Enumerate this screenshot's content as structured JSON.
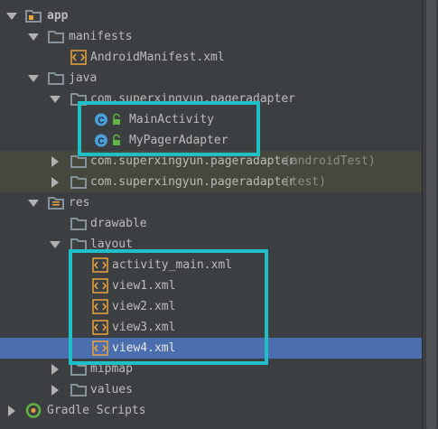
{
  "tree": {
    "app": "app",
    "manifests": "manifests",
    "manifest_file": "AndroidManifest.xml",
    "java": "java",
    "pkg_main": "com.superxingyun.pageradapter",
    "main_activity": "MainActivity",
    "pager_adapter": "MyPagerAdapter",
    "pkg_android_test": "com.superxingyun.pageradapter",
    "pkg_android_test_suffix": "(androidTest)",
    "pkg_test": "com.superxingyun.pageradapter",
    "pkg_test_suffix": "(test)",
    "res": "res",
    "drawable": "drawable",
    "layout": "layout",
    "layout_files": [
      "activity_main.xml",
      "view1.xml",
      "view2.xml",
      "view3.xml",
      "view4.xml"
    ],
    "mipmap": "mipmap",
    "values": "values",
    "gradle": "Gradle Scripts"
  },
  "colors": {
    "background": "#3c3f41",
    "selection": "#4b6eaf",
    "test_highlight": "#45493d",
    "callout": "#1fbfc7",
    "folder": "#87939a",
    "xml_icon": "#e8a33d",
    "class_icon": "#4a9fd8",
    "lock_icon": "#62b543"
  },
  "selected_item": "view4.xml"
}
